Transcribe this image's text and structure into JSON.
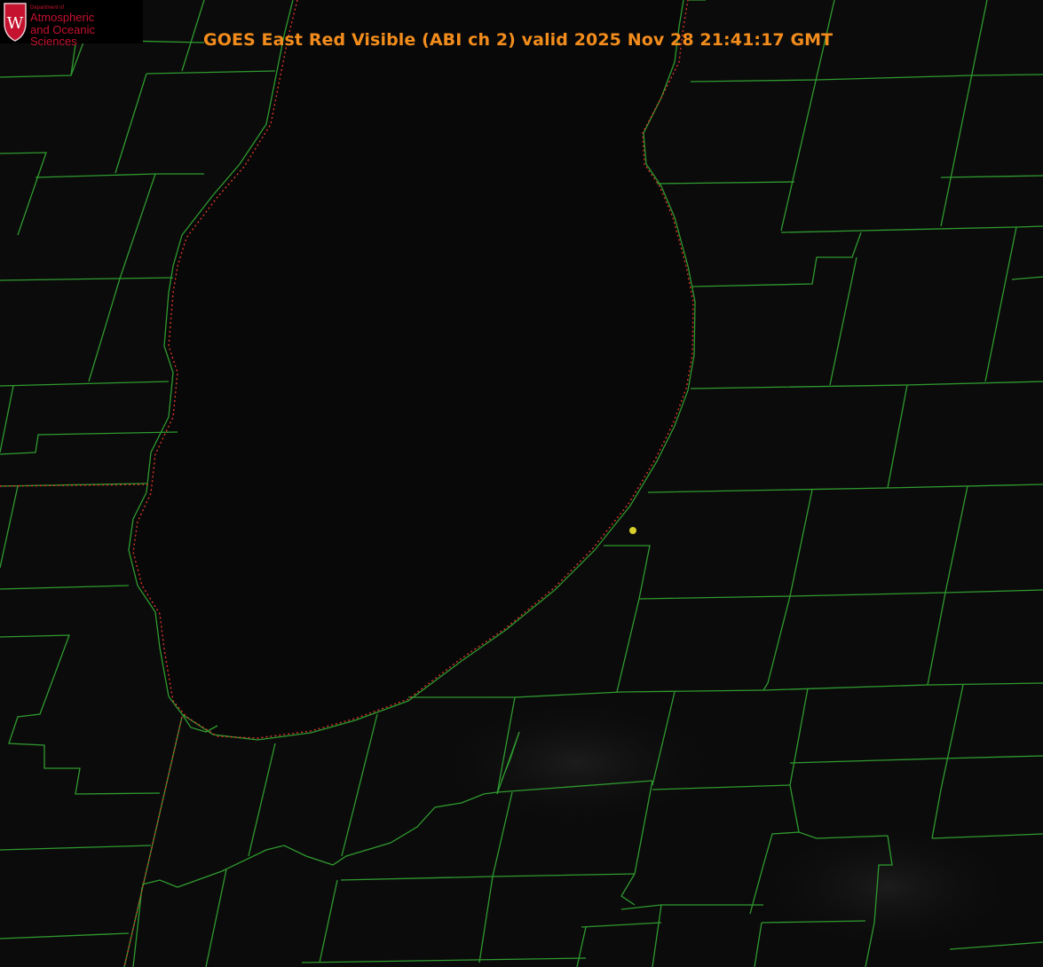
{
  "title": "GOES East Red Visible (ABI ch 2) valid 2025 Nov 28 21:41:17 GMT",
  "logo": {
    "department": "Department of",
    "line1": "Atmospheric",
    "line2": "and Oceanic Sciences",
    "crest_letter": "W"
  },
  "colors": {
    "background": "#000000",
    "county_lines": "#2f9a2f",
    "state_border": "#d9362a",
    "title": "#f28c1c",
    "point_marker": "#d8cf2a",
    "logo_red": "#c4122f"
  }
}
